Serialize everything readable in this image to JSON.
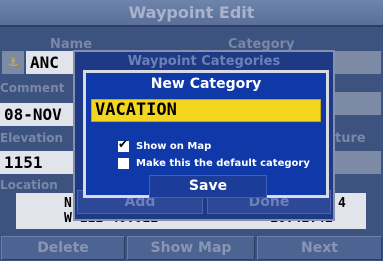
{
  "screen": {
    "title": "Waypoint Edit",
    "name_label": "Name",
    "category_label": "Category",
    "name_value": "ANC",
    "symbol_icon": "anchor-icon",
    "comment_label": "Comment",
    "comment_value": "08-NOV",
    "elevation_label": "Elevation",
    "elevation_value": "1151",
    "temperature_label": "ture",
    "location_label": "Location",
    "location_line1": "N",
    "location_line2": "W 111 40.011",
    "location_right1": "4",
    "location_right2": "16.41.41"
  },
  "waypoint_categories": {
    "title": "Waypoint Categories",
    "add_label": "Add",
    "done_label": "Done"
  },
  "new_category": {
    "title": "New Category",
    "input_value": "VACATION",
    "options": [
      {
        "label": "Show on Map",
        "checked": true
      },
      {
        "label": "Make this the default category",
        "checked": false
      }
    ],
    "save_label": "Save"
  },
  "softkeys": {
    "delete_label": "Delete",
    "show_map_label": "Show Map",
    "next_label": "Next"
  },
  "colors": {
    "background": "#3c527f",
    "dialog": "#0f38a8",
    "input_highlight": "#f4d61e"
  }
}
